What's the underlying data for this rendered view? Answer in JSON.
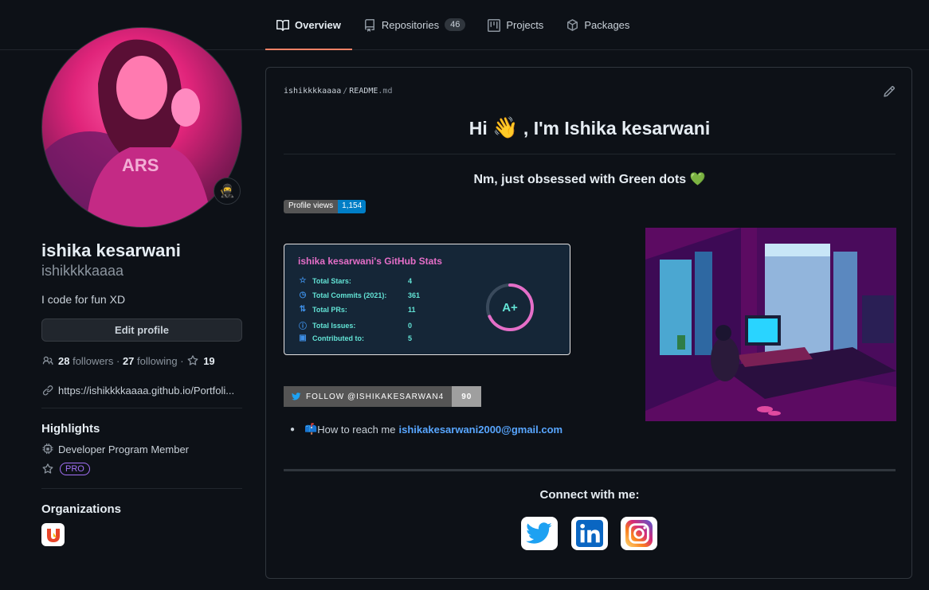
{
  "tabs": [
    {
      "label": "Overview",
      "icon": "book-icon",
      "active": true
    },
    {
      "label": "Repositories",
      "icon": "repo-icon",
      "count": "46"
    },
    {
      "label": "Projects",
      "icon": "project-icon"
    },
    {
      "label": "Packages",
      "icon": "package-icon"
    }
  ],
  "profile": {
    "full_name": "ishika kesarwani",
    "username": "ishikkkkaaaa",
    "bio": "I code for fun XD",
    "edit_label": "Edit profile",
    "followers_count": "28",
    "followers_label": "followers",
    "following_count": "27",
    "following_label": "following",
    "stars_count": "19",
    "website": "https://ishikkkkaaaa.github.io/Portfoli...",
    "status_emoji": "🥷"
  },
  "highlights": {
    "title": "Highlights",
    "developer": "Developer Program Member",
    "pro": "PRO"
  },
  "organizations": {
    "title": "Organizations"
  },
  "readme": {
    "owner": "ishikkkkaaaa",
    "file": "README",
    "ext": ".md",
    "heading_pre": "Hi ",
    "heading_emoji": "👋",
    "heading_post": " , I'm Ishika kesarwani",
    "tagline": "Nm, just obsessed with Green dots 💚",
    "views_label": "Profile views",
    "views_count": "1,154",
    "stats": {
      "title": "ishika kesarwani's GitHub Stats",
      "rows": [
        {
          "label": "Total Stars:",
          "value": "4"
        },
        {
          "label": "Total Commits (2021):",
          "value": "361"
        },
        {
          "label": "Total PRs:",
          "value": "11"
        },
        {
          "label": "Total Issues:",
          "value": "0"
        },
        {
          "label": "Contributed to:",
          "value": "5"
        }
      ],
      "grade": "A+"
    },
    "twitter_label": "FOLLOW @ISHIKAKESARWAN4",
    "twitter_count": "90",
    "reach_emoji": "📫",
    "reach_text": "How to reach me",
    "reach_email": "ishikakesarwani2000@gmail.com",
    "connect": "Connect with me:"
  },
  "colors": {
    "accent_tab": "#f78166",
    "link": "#58a6ff",
    "stats_title": "#e56ec8",
    "stats_text": "#63e4d6",
    "pro": "#a371f7"
  }
}
